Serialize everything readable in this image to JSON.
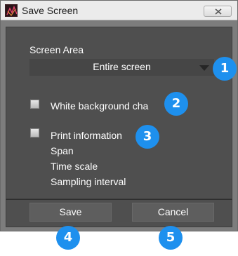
{
  "window": {
    "title": "Save Screen",
    "app_icon": "app-logo-icon",
    "close_icon": "close-icon"
  },
  "screen_area": {
    "label": "Screen Area",
    "selected": "Entire screen"
  },
  "options": {
    "white_background_label": "White background cha",
    "white_background_checked": false,
    "print_information_label": "Print information",
    "print_information_checked": false,
    "print_information_items": [
      "Span",
      "Time scale",
      "Sampling interval"
    ]
  },
  "buttons": {
    "save": "Save",
    "cancel": "Cancel"
  },
  "callouts": [
    "1",
    "2",
    "3",
    "4",
    "5"
  ],
  "colors": {
    "callout": "#1e90ee",
    "panel": "#4f4f4f",
    "window": "#7d7d7d"
  }
}
